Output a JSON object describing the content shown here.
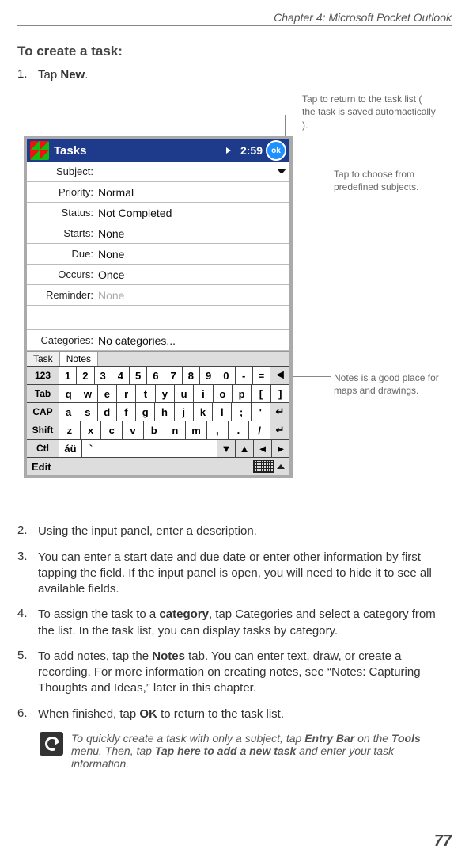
{
  "chapter": "Chapter 4: Microsoft Pocket Outlook",
  "heading": "To create a task:",
  "steps": [
    {
      "n": "1.",
      "pre": "Tap ",
      "b1": "New",
      "post": "."
    },
    {
      "n": "2.",
      "text": "Using the input panel, enter a description."
    },
    {
      "n": "3.",
      "text": "You can enter a start date and due date or enter other information by first tapping the field. If the input panel is open, you will need to hide it to see all available fields."
    },
    {
      "n": "4.",
      "pre": "To assign the task to a ",
      "b1": "category",
      "post": ", tap  Categories  and select a category from the list. In the task list, you can display tasks by category."
    },
    {
      "n": "5.",
      "pre": "To add notes, tap the  ",
      "b1": "Notes",
      "post": "  tab. You can enter text, draw, or create a recording. For more information on creating notes, see “Notes: Capturing Thoughts and Ideas,” later in this chapter."
    },
    {
      "n": "6.",
      "pre": "When finished, tap  ",
      "b1": "OK",
      "post": "  to return to the task list."
    }
  ],
  "callouts": {
    "top": "Tap to return to the task list ( the task is saved automactically ).",
    "mid": "Tap to choose from predefined subjects.",
    "low": "Notes is a good place for maps and drawings."
  },
  "device": {
    "title": "Tasks",
    "clock": "2:59",
    "ok": "ok",
    "fields": {
      "subject_lbl": "Subject:",
      "subject_val": "",
      "priority_lbl": "Priority:",
      "priority_val": "Normal",
      "status_lbl": "Status:",
      "status_val": "Not Completed",
      "starts_lbl": "Starts:",
      "starts_val": "None",
      "due_lbl": "Due:",
      "due_val": "None",
      "occurs_lbl": "Occurs:",
      "occurs_val": "Once",
      "reminder_lbl": "Reminder:",
      "reminder_val": "None",
      "categories_lbl": "Categories:",
      "categories_val": "No categories..."
    },
    "tabs": {
      "task": "Task",
      "notes": "Notes"
    },
    "kbd": {
      "r1_fn": "123",
      "r1": [
        "1",
        "2",
        "3",
        "4",
        "5",
        "6",
        "7",
        "8",
        "9",
        "0",
        "-",
        "="
      ],
      "r2_fn": "Tab",
      "r2": [
        "q",
        "w",
        "e",
        "r",
        "t",
        "y",
        "u",
        "i",
        "o",
        "p",
        "[",
        "]"
      ],
      "r3_fn": "CAP",
      "r3": [
        "a",
        "s",
        "d",
        "f",
        "g",
        "h",
        "j",
        "k",
        "l",
        ";",
        "'"
      ],
      "r4_fn": "Shift",
      "r4": [
        "z",
        "x",
        "c",
        "v",
        "b",
        "n",
        "m",
        ",",
        ".",
        "/"
      ],
      "r5_fn": "Ctl",
      "r5_accent": "áü",
      "r5_grave": "`",
      "edit": "Edit"
    }
  },
  "tip": {
    "pre": "To quickly create a task with only a subject, tap  ",
    "b1": "Entry Bar",
    "mid1": "  on the ",
    "b2": "Tools",
    "mid2": " menu. Then, tap ",
    "b3": "Tap here to add a new  task",
    "post": " and enter your task information."
  },
  "page_number": "77"
}
